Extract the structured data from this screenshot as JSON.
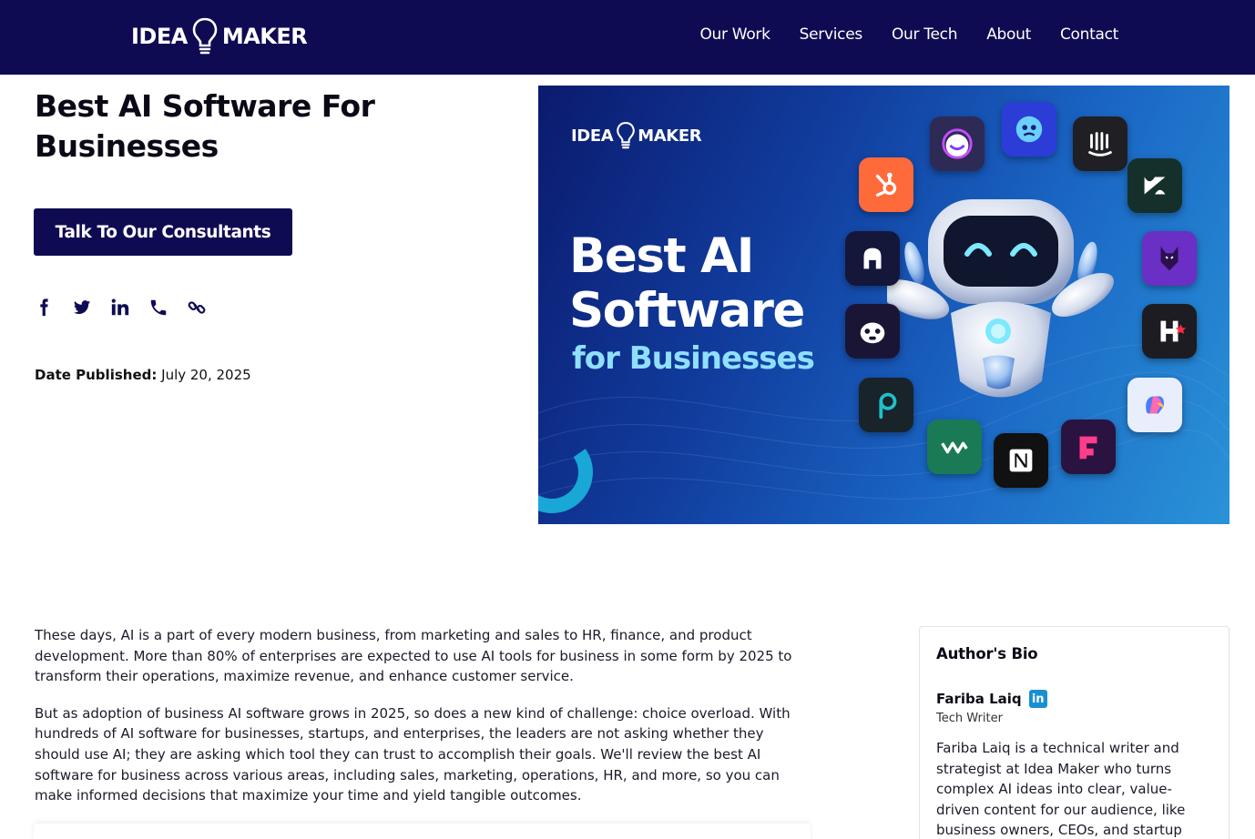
{
  "nav": {
    "logo_left": "IDEA",
    "logo_right": "MAKER",
    "links": [
      "Our Work",
      "Services",
      "Our Tech",
      "About",
      "Contact"
    ]
  },
  "hero": {
    "title": "Best AI Software For Businesses",
    "cta_label": "Talk To Our Consultants",
    "share_icons": [
      "facebook-icon",
      "twitter-icon",
      "linkedin-icon",
      "phone-icon",
      "link-icon"
    ],
    "date_label": "Date Published:",
    "date_value": "July 20, 2025"
  },
  "banner": {
    "logo_left": "IDEA",
    "logo_right": "MAKER",
    "headline_1": "Best AI",
    "headline_2": "Software",
    "subheadline": "for Businesses",
    "apps": [
      "jasper-icon",
      "genie-icon",
      "intercom-icon",
      "hubspot-icon",
      "zendesk-icon",
      "ahrefs-icon",
      "doberman-icon",
      "monkey-icon",
      "hackerrank-icon",
      "pipedrive-icon",
      "copilot-icon",
      "workvivo-icon",
      "notion-icon",
      "framer-icon"
    ],
    "colors": {
      "accent": "#8fe0ff",
      "bg_start": "#0b1a6e",
      "bg_end": "#2a93d8"
    }
  },
  "article": {
    "paragraphs": [
      "These days, AI is a part of every modern business, from marketing and sales to HR, finance, and product development. More than 80% of enterprises are expected to use AI tools for business in some form by 2025 to transform their operations, maximize revenue, and enhance customer service.",
      "But as adoption of business AI software grows in 2025, so does a new kind of challenge: choice overload. With hundreds of AI software for businesses, startups, and enterprises, the leaders are not asking whether they should use AI; they are asking which tool they can trust to accomplish their goals. We'll review the best AI software for business across various areas, including sales, marketing, operations, HR, and more, so you can make informed decisions that maximize your time and yield tangible outcomes."
    ]
  },
  "bio": {
    "heading": "Author's Bio",
    "name": "Fariba Laiq",
    "linkedin_badge": "in",
    "role": "Tech Writer",
    "text": "Fariba Laiq is a technical writer and strategist at Idea Maker who turns complex AI ideas into clear, value-driven content for our audience, like business owners, CEOs, and startup founders."
  },
  "colors": {
    "brand_navy": "#0f0b52",
    "linkedin_blue": "#1a8fd1"
  }
}
